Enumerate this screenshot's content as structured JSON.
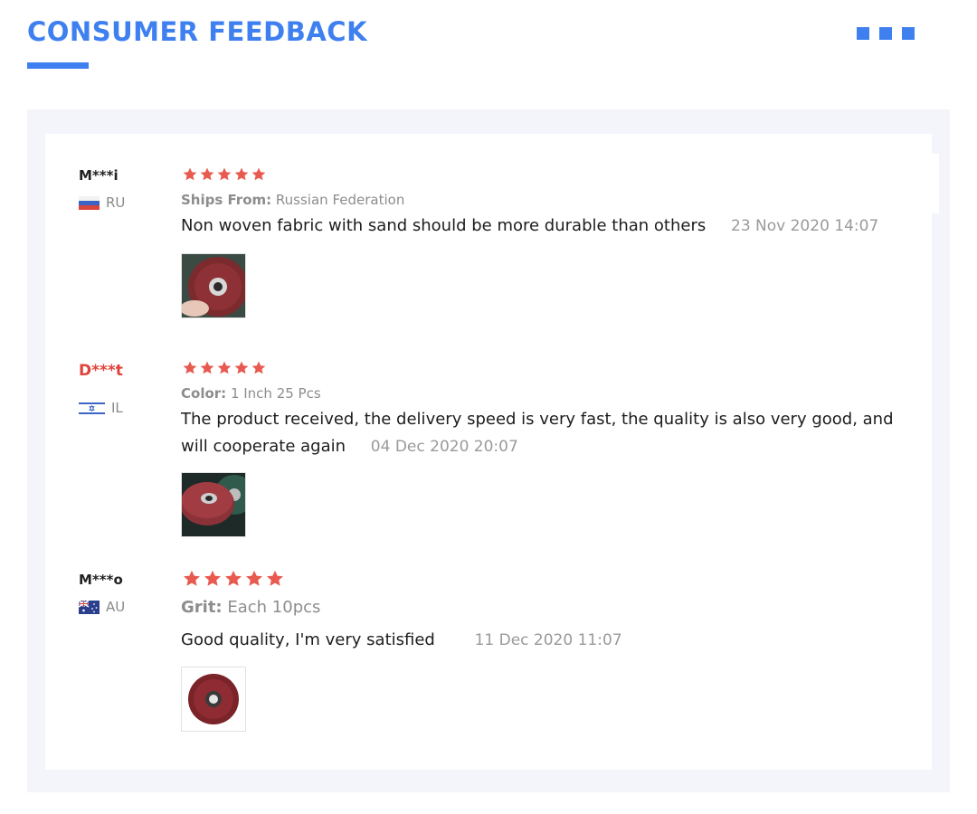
{
  "header": {
    "title": "CONSUMER FEEDBACK",
    "accent_color": "#3f80f0"
  },
  "reviews": [
    {
      "user": "M***i",
      "country": "RU",
      "flag_icon": "russia-flag-icon",
      "rating": 5,
      "attr_label": "Ships From:",
      "attr_value": "Russian Federation",
      "text": "Non woven fabric with sand should be more durable than others",
      "date": "23 Nov 2020 14:07",
      "photo_icon": "flap-disc-in-hand-photo"
    },
    {
      "user": "D***t",
      "country": "IL",
      "flag_icon": "israel-flag-icon",
      "rating": 5,
      "attr_label": "Color:",
      "attr_value": "1 Inch 25 Pcs",
      "text": "The product received, the delivery speed is very fast, the quality is also very good, and will cooperate again",
      "date": "04 Dec 2020 20:07",
      "photo_icon": "stacked-flap-discs-photo"
    },
    {
      "user": "M***o",
      "country": "AU",
      "flag_icon": "australia-flag-icon",
      "rating": 5,
      "attr_label": "Grit:",
      "attr_value": "Each 10pcs",
      "text": "Good quality, I'm very satisfied",
      "date": "11 Dec 2020 11:07",
      "photo_icon": "single-flap-disc-photo"
    }
  ],
  "colors": {
    "star": "#e85a4f",
    "highlighted_user": "#e0433b",
    "panel_bg": "#f3f5fa"
  }
}
